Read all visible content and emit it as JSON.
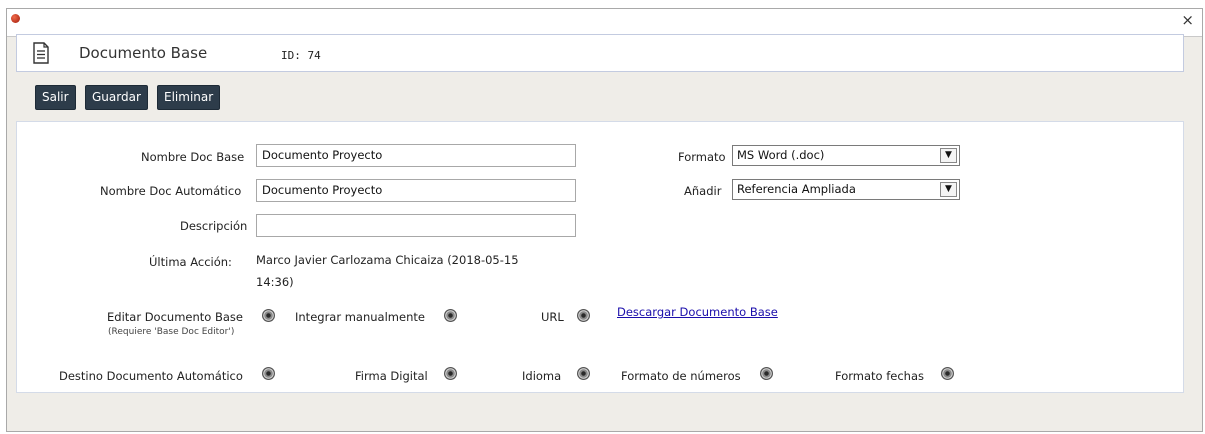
{
  "window": {
    "close_glyph": "×"
  },
  "header": {
    "title": "Documento Base",
    "id": "ID: 74",
    "icon": "document-icon"
  },
  "toolbar": {
    "salir": "Salir",
    "guardar": "Guardar",
    "eliminar": "Eliminar"
  },
  "form": {
    "nombre_doc_base": {
      "label": "Nombre Doc Base",
      "value": "Documento Proyecto"
    },
    "nombre_doc_auto": {
      "label": "Nombre Doc Automático",
      "value": "Documento Proyecto"
    },
    "descripcion": {
      "label": "Descripción",
      "value": ""
    },
    "ultima_accion": {
      "label": "Última Acción:",
      "value": "Marco Javier Carlozama Chicaiza (2018-05-15 14:36)"
    },
    "formato": {
      "label": "Formato",
      "value": "MS Word (.doc)"
    },
    "anadir": {
      "label": "Añadir",
      "value": "Referencia Ampliada"
    },
    "editar_doc_base": {
      "label": "Editar Documento Base",
      "note": "(Requiere 'Base Doc Editor')"
    },
    "integrar_manualmente": {
      "label": "Integrar manualmente"
    },
    "url": {
      "label": "URL"
    },
    "descargar_link": "Descargar Documento Base",
    "destino_doc_auto": {
      "label": "Destino Documento Automático"
    },
    "firma_digital": {
      "label": "Firma Digital"
    },
    "idioma": {
      "label": "Idioma"
    },
    "formato_numeros": {
      "label": "Formato de números"
    },
    "formato_fechas": {
      "label": "Formato fechas"
    }
  },
  "icons": {
    "eye": "eye-icon",
    "app": "app-dot-icon",
    "close": "close-icon"
  }
}
